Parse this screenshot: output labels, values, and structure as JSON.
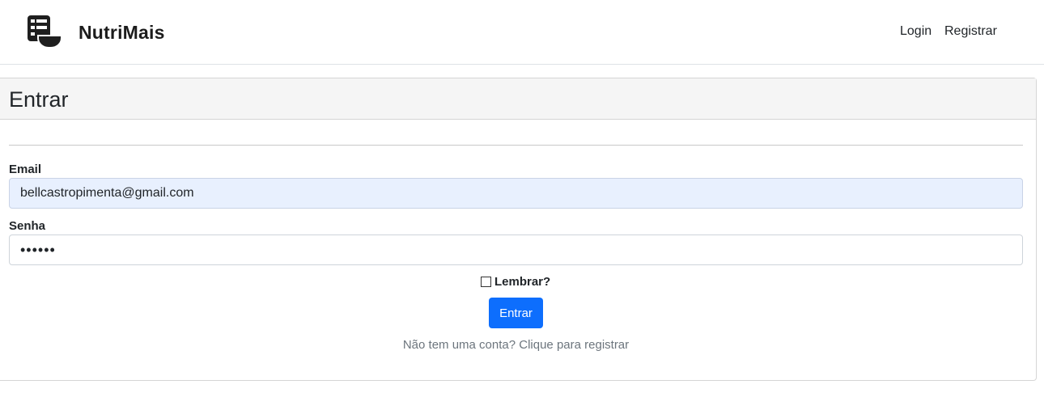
{
  "navbar": {
    "brand": "NutriMais",
    "logo_icon": "menu-bowl-icon",
    "links": {
      "login": "Login",
      "register": "Registrar"
    }
  },
  "card": {
    "title": "Entrar",
    "email": {
      "label": "Email",
      "value": "bellcastropimenta@gmail.com"
    },
    "password": {
      "label": "Senha",
      "value": "••••••"
    },
    "remember": {
      "label": "Lembrar?",
      "checked": false
    },
    "submit_label": "Entrar",
    "register_hint": "Não tem uma conta? Clique para registrar"
  },
  "colors": {
    "primary": "#0d6efd",
    "autofill_bg": "#e8f0fe",
    "muted_text": "#6c757d",
    "header_bg": "#f5f5f5"
  }
}
